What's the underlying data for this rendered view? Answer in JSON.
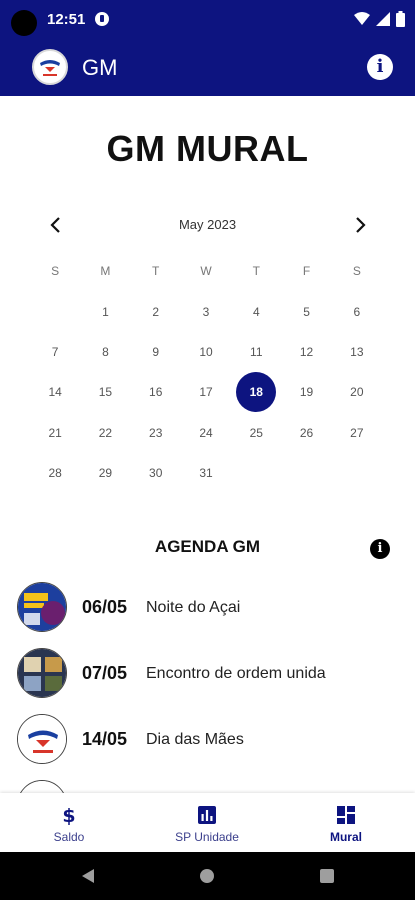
{
  "status_bar": {
    "time": "12:51"
  },
  "app_bar": {
    "title": "GM"
  },
  "page": {
    "title": "GM MURAL"
  },
  "calendar": {
    "month_label": "May 2023",
    "weekdays": [
      "S",
      "M",
      "T",
      "W",
      "T",
      "F",
      "S"
    ],
    "first_weekday_index": 1,
    "days_in_month": 31,
    "selected_day": "18"
  },
  "agenda": {
    "title": "AGENDA GM",
    "items": [
      {
        "date": "06/05",
        "name": "Noite do Açai"
      },
      {
        "date": "07/05",
        "name": "Encontro de ordem unida"
      },
      {
        "date": "14/05",
        "name": "Dia das Mães"
      }
    ]
  },
  "bottom_nav": {
    "items": [
      {
        "label": "Saldo",
        "icon": "dollar-icon",
        "active": false
      },
      {
        "label": "SP Unidade",
        "icon": "bar-chart-icon",
        "active": false
      },
      {
        "label": "Mural",
        "icon": "dashboard-icon",
        "active": true
      }
    ]
  },
  "colors": {
    "primary": "#0d1480",
    "text_dark": "#111111",
    "muted": "#777777"
  }
}
